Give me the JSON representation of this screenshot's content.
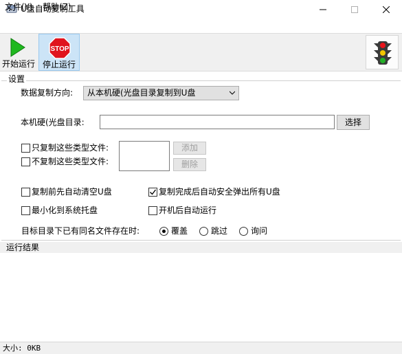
{
  "window": {
    "title": "U盘自动复制工具",
    "controls": {
      "minimize": "—",
      "maximize": "☐",
      "close": "✕"
    }
  },
  "menu": {
    "file": "文件(Y)",
    "help": "帮助(Z)"
  },
  "toolbar": {
    "start_label": "开始运行",
    "stop_label": "停止运行",
    "stop_sign_text": "STOP"
  },
  "settings": {
    "legend": "设置",
    "direction_label": "数据复制方向:",
    "direction_value": "从本机硬(光盘目录复制到U盘",
    "path_label": "本机硬(光盘目录:",
    "path_value": "",
    "browse_label": "选择",
    "only_types_label": "只复制这些类型文件:",
    "exclude_types_label": "不复制这些类型文件:",
    "add_label": "添加",
    "delete_label": "删除",
    "clear_before_label": "复制前先自动清空U盘",
    "eject_after_label": "复制完成后自动安全弹出所有U盘",
    "minimize_tray_label": "最小化到系统托盘",
    "autostart_label": "开机后自动运行",
    "conflict_label": "目标目录下已有同名文件存在时:",
    "radio_overwrite": "覆盖",
    "radio_skip": "跳过",
    "radio_ask": "询问",
    "checked": {
      "only_types": false,
      "exclude_types": false,
      "clear_before": false,
      "eject_after": true,
      "minimize_tray": false,
      "autostart": false
    },
    "selected_conflict": "覆盖"
  },
  "results": {
    "label": "运行结果"
  },
  "status": {
    "size_text": "大小: 0KB"
  },
  "colors": {
    "play_green": "#1fb81f",
    "stop_red": "#e0141e",
    "light_red": "#e8141b",
    "light_yellow": "#f2c500",
    "light_green": "#22b027",
    "selection_blue": "#cce4f7"
  }
}
